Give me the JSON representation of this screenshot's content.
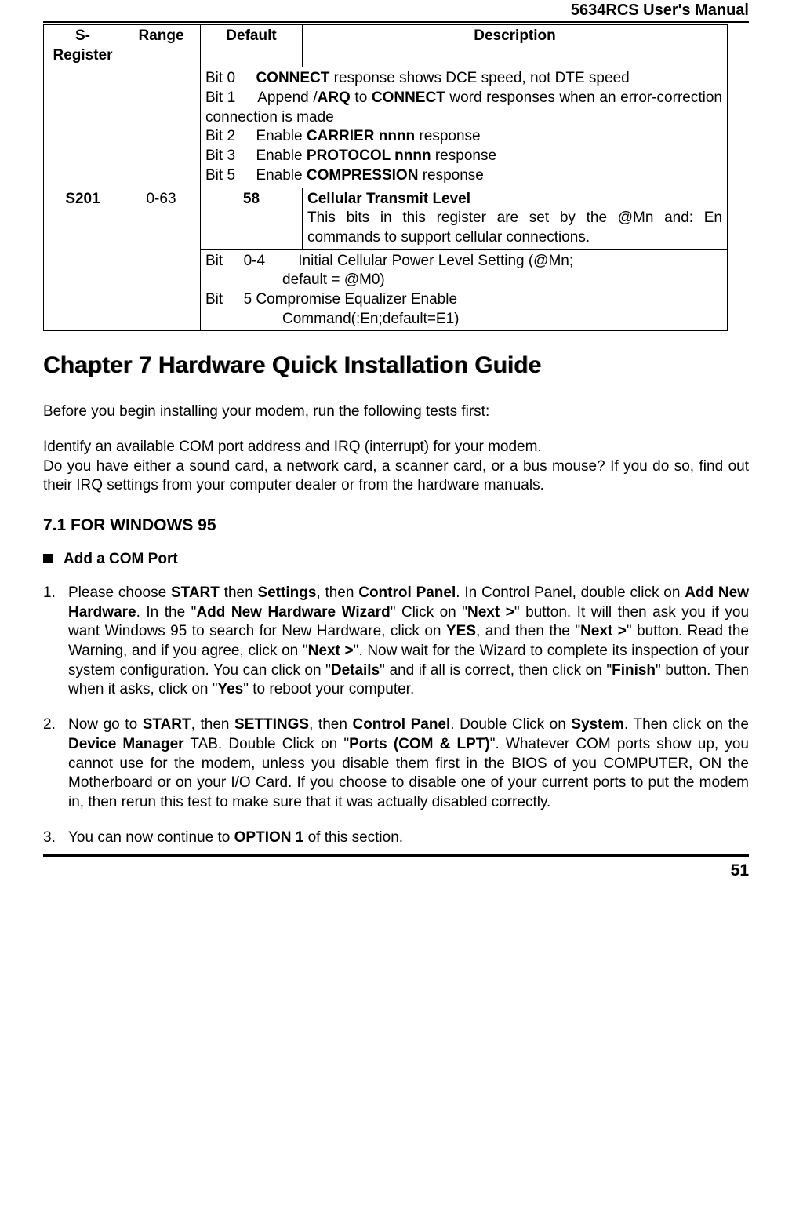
{
  "header": {
    "title": "5634RCS User's Manual"
  },
  "table": {
    "headers": {
      "sreg": "S-Register",
      "range": "Range",
      "default": "Default",
      "description": "Description"
    },
    "row1": {
      "bit0_label": "Bit 0",
      "bit0_text_a": "CONNECT",
      "bit0_text_b": " response shows DCE speed, not DTE speed",
      "bit1_label": "Bit 1",
      "bit1_a": "Append /",
      "bit1_b": "ARQ",
      "bit1_c": " to ",
      "bit1_d": "CONNECT",
      "bit1_e": " word responses when an error-correction connection is made",
      "bit2_label": "Bit 2",
      "bit2_a": "Enable ",
      "bit2_b": "CARRIER nnnn",
      "bit2_c": " response",
      "bit3_label": "Bit 3",
      "bit3_a": "Enable ",
      "bit3_b": "PROTOCOL nnnn",
      "bit3_c": " response",
      "bit5_label": "Bit 5",
      "bit5_a": "Enable ",
      "bit5_b": "COMPRESSION",
      "bit5_c": " response"
    },
    "row2": {
      "sreg": "S201",
      "range": "0-63",
      "default": "58",
      "desc_title": "Cellular Transmit Level",
      "desc_body": "This bits in this register are set by the @Mn and: En commands to support cellular connections.",
      "sub_bit_a": "Bit     0-4",
      "sub_bit_a_text": "Initial Cellular Power Level Setting (@Mn;",
      "sub_bit_a_text2": "default = @M0)",
      "sub_bit_b": "Bit     5 Compromise Equalizer Enable",
      "sub_bit_b_text": "Command(:En;default=E1)"
    }
  },
  "chapter": {
    "title": "Chapter 7 Hardware Quick Installation Guide"
  },
  "intro": {
    "p1": "Before you begin installing your modem, run the following tests first:",
    "p2": "Identify an available COM port address and IRQ (interrupt) for your modem.",
    "p3": "Do you have either a sound card, a network card, a scanner card, or a bus mouse? If you do so, find out their IRQ settings from your computer dealer or from the hardware manuals."
  },
  "section71": {
    "title": "7.1 FOR WINDOWS 95"
  },
  "bullet": {
    "title": "Add a COM Port"
  },
  "steps": {
    "s1": {
      "marker": "1.",
      "t1": "Please choose ",
      "b1": "START",
      "t2": " then ",
      "b2": "Settings",
      "t3": ", then ",
      "b3": "Control Panel",
      "t4": ".     In Control Panel, double click on ",
      "b4": "Add New Hardware",
      "t5": ".     In the \"",
      "b5": "Add New Hardware Wizard",
      "t6": "\" Click on     \"",
      "b6": "Next >",
      "t7": "\" button. It will then ask you if you want Windows 95 to search for New Hardware, click on ",
      "b7": "YES",
      "t8": ", and then the \"",
      "b8": "Next >",
      "t9": "\" button.    Read the Warning, and if you agree, click on \"",
      "b9": "Next >",
      "t10": "\".    Now wait for the Wizard to complete its inspection of your system configuration.    You can click on \"",
      "b10": "Details",
      "t11": "\" and if all is correct, then click on \"",
      "b11": "Finish",
      "t12": "\" button.     Then when it asks, click on \"",
      "b12": "Yes",
      "t13": "\" to reboot your computer."
    },
    "s2": {
      "marker": "2.",
      "t1": "Now go to ",
      "b1": "START",
      "t2": ", then ",
      "b2": "SETTINGS",
      "t3": ", then ",
      "b3": "Control Panel",
      "t4": ".    Double Click on ",
      "b4": "System",
      "t5": ". Then click on the ",
      "b5": "Device Manager",
      "t6": " TAB.    Double Click on \"",
      "b6": "Ports (COM & LPT)",
      "t7": "\". Whatever COM ports show up, you cannot use for the modem, unless you disable them first in the BIOS of you COMPUTER, ON the Motherboard or on your I/O Card. If you choose to disable one of your current ports to put the modem in, then rerun this test to make sure that it was actually disabled correctly."
    },
    "s3": {
      "marker": "3.",
      "t1": "You can now continue to ",
      "b1": "OPTION 1",
      "t2": " of this section."
    }
  },
  "footer": {
    "page": "51"
  }
}
